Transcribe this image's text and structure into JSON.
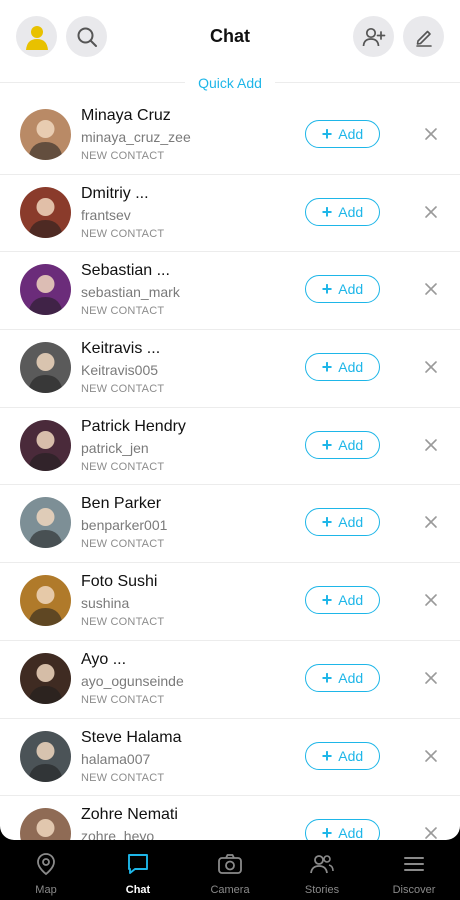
{
  "header": {
    "title": "Chat",
    "section_label": "Quick Add"
  },
  "contacts": [
    {
      "name": "Minaya Cruz",
      "username": "minaya_cruz_zee",
      "tag": "NEW CONTACT",
      "add_label": "Add",
      "color": "#b98a66"
    },
    {
      "name": "Dmitriy ...",
      "username": "frantsev",
      "tag": "NEW CONTACT",
      "add_label": "Add",
      "color": "#8a3b2b"
    },
    {
      "name": "Sebastian ...",
      "username": "sebastian_mark",
      "tag": "NEW CONTACT",
      "add_label": "Add",
      "color": "#6b2c7a"
    },
    {
      "name": "Keitravis ...",
      "username": "Keitravis005",
      "tag": "NEW CONTACT",
      "add_label": "Add",
      "color": "#5a5a5a"
    },
    {
      "name": "Patrick Hendry",
      "username": "patrick_jen",
      "tag": "NEW CONTACT",
      "add_label": "Add",
      "color": "#4a2a3a"
    },
    {
      "name": "Ben Parker",
      "username": "benparker001",
      "tag": "NEW CONTACT",
      "add_label": "Add",
      "color": "#7d8f96"
    },
    {
      "name": "Foto Sushi",
      "username": "sushina",
      "tag": "NEW CONTACT",
      "add_label": "Add",
      "color": "#b07a2a"
    },
    {
      "name": "Ayo ...",
      "username": "ayo_ogunseinde",
      "tag": "NEW CONTACT",
      "add_label": "Add",
      "color": "#3f2b22"
    },
    {
      "name": "Steve Halama",
      "username": "halama007",
      "tag": "NEW CONTACT",
      "add_label": "Add",
      "color": "#4b5357"
    },
    {
      "name": "Zohre Nemati",
      "username": "zohre_heyo",
      "tag": "",
      "add_label": "Add",
      "color": "#8f6b55"
    }
  ],
  "tabs": [
    {
      "label": "Map",
      "icon": "map-pin-icon"
    },
    {
      "label": "Chat",
      "icon": "chat-bubble-icon",
      "active": true
    },
    {
      "label": "Camera",
      "icon": "camera-icon"
    },
    {
      "label": "Stories",
      "icon": "people-icon"
    },
    {
      "label": "Discover",
      "icon": "menu-icon"
    }
  ],
  "colors": {
    "accent": "#1eb6e8",
    "avatar_fill": "#e8c100",
    "header_button_bg": "#e9e9ec"
  }
}
